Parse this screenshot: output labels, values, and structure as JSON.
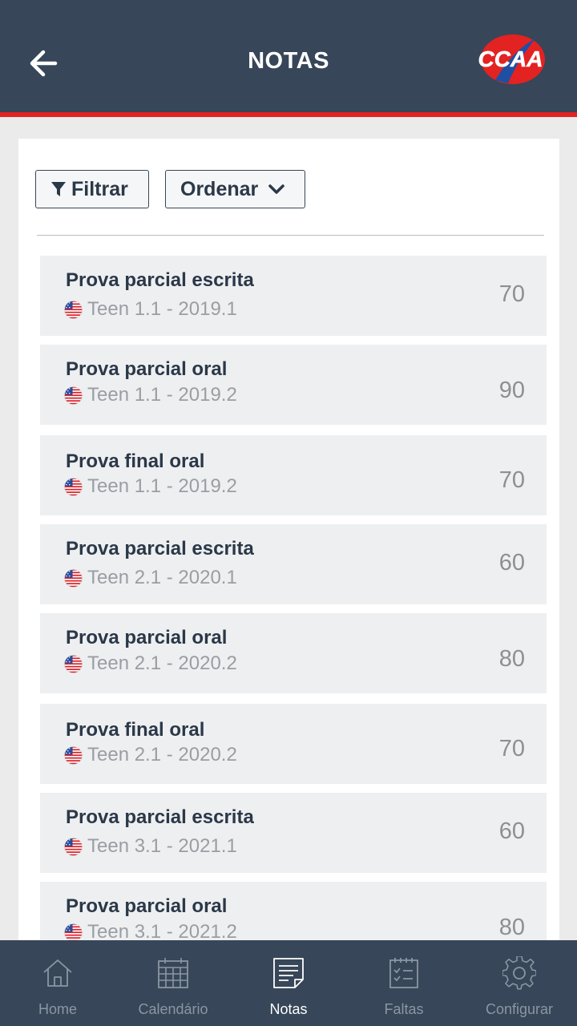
{
  "header": {
    "title": "NOTAS",
    "back_icon": "arrow-left-icon",
    "logo_text": "CCAA",
    "colors": {
      "bar": "#374658",
      "accent": "#e32222"
    }
  },
  "toolbar": {
    "filter_label": "Filtrar",
    "order_label": "Ordenar"
  },
  "grades": [
    {
      "title": "Prova parcial escrita",
      "course": "Teen 1.1 - 2019.1",
      "score": "70"
    },
    {
      "title": "Prova parcial oral",
      "course": "Teen 1.1 - 2019.2",
      "score": "90"
    },
    {
      "title": "Prova final oral",
      "course": "Teen 1.1 - 2019.2",
      "score": "70"
    },
    {
      "title": "Prova parcial escrita",
      "course": "Teen 2.1 - 2020.1",
      "score": "60"
    },
    {
      "title": "Prova parcial oral",
      "course": "Teen 2.1 - 2020.2",
      "score": "80"
    },
    {
      "title": "Prova final oral",
      "course": "Teen 2.1 - 2020.2",
      "score": "70"
    },
    {
      "title": "Prova parcial escrita",
      "course": "Teen 3.1 - 2021.1",
      "score": "60"
    },
    {
      "title": "Prova parcial oral",
      "course": "Teen 3.1 - 2021.2",
      "score": "80"
    }
  ],
  "nav": {
    "items": [
      {
        "label": "Home",
        "icon": "home-icon"
      },
      {
        "label": "Calendário",
        "icon": "calendar-icon"
      },
      {
        "label": "Notas",
        "icon": "notes-icon",
        "active": true
      },
      {
        "label": "Faltas",
        "icon": "attendance-icon"
      },
      {
        "label": "Configurar",
        "icon": "gear-icon"
      }
    ]
  }
}
